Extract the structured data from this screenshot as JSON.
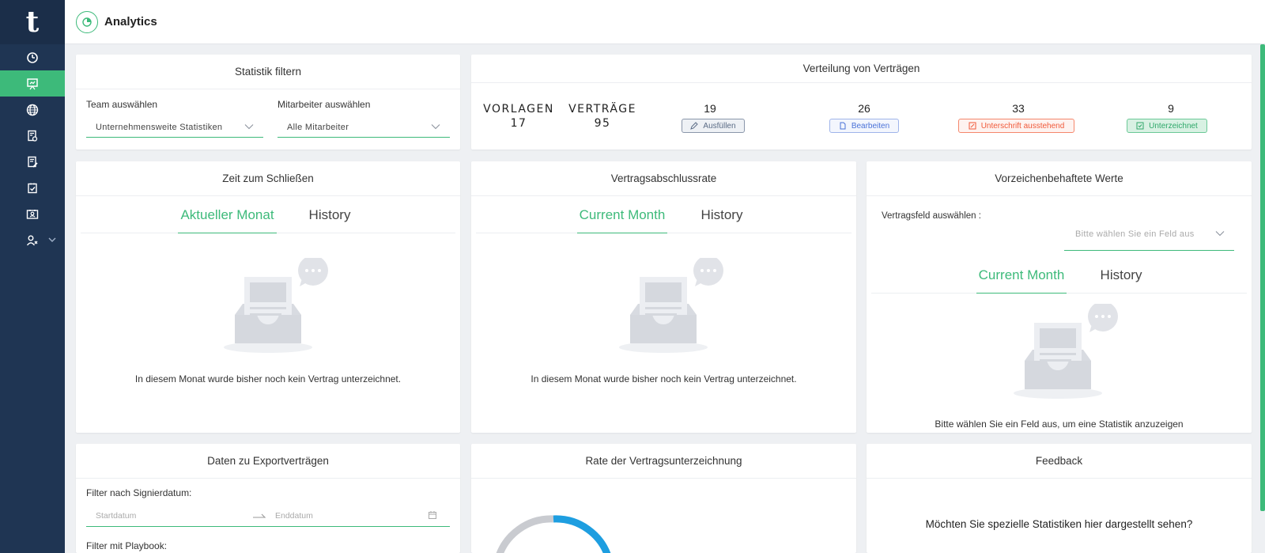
{
  "header": {
    "title": "Analytics"
  },
  "sidebar": {
    "logo": "t",
    "items": [
      "dashboard-icon",
      "presentation-icon",
      "globe-icon",
      "document-settings-icon",
      "document-edit-icon",
      "document-check-icon",
      "id-card-icon",
      "users-icon"
    ]
  },
  "filter": {
    "title": "Statistik filtern",
    "team_label": "Team auswählen",
    "team_value": "Unternehmensweite Statistiken",
    "employee_label": "Mitarbeiter auswählen",
    "employee_value": "Alle Mitarbeiter"
  },
  "distribution": {
    "title": "Verteilung von Verträgen",
    "templates_label": "VORLAGEN",
    "templates_count": "17",
    "contracts_label": "VERTRÄGE",
    "contracts_count": "95",
    "statuses": [
      {
        "count": "19",
        "label": "Ausfüllen",
        "color": "#5a6b85"
      },
      {
        "count": "26",
        "label": "Bearbeiten",
        "color": "#4a72d8"
      },
      {
        "count": "33",
        "label": "Unterschrift ausstehend",
        "color": "#f05a3a"
      },
      {
        "count": "9",
        "label": "Unterzeichnet",
        "color": "#2fa86a"
      }
    ]
  },
  "close_time": {
    "title": "Zeit zum Schließen",
    "tab_current": "Aktueller Monat",
    "tab_history": "History",
    "empty": "In diesem Monat wurde bisher noch kein Vertrag unterzeichnet."
  },
  "completion_rate": {
    "title": "Vertragsabschlussrate",
    "tab_current": "Current Month",
    "tab_history": "History",
    "empty": "In diesem Monat wurde bisher noch kein Vertrag unterzeichnet."
  },
  "signed_values": {
    "title": "Vorzeichenbehaftete Werte",
    "field_label": "Vertragsfeld auswählen :",
    "field_placeholder": "Bitte wählen Sie ein Feld aus",
    "tab_current": "Current Month",
    "tab_history": "History",
    "empty": "Bitte wählen Sie ein Feld aus, um eine Statistik anzuzeigen"
  },
  "export": {
    "title": "Daten zu Exportverträgen",
    "date_filter_label": "Filter nach Signierdatum:",
    "start_placeholder": "Startdatum",
    "end_placeholder": "Enddatum",
    "playbook_label": "Filter mit Playbook:"
  },
  "signing_rate": {
    "title": "Rate der Vertragsunterzeichnung"
  },
  "feedback": {
    "title": "Feedback",
    "question": "Möchten Sie spezielle Statistiken hier dargestellt sehen?"
  },
  "colors": {
    "accent": "#3dba7a",
    "sidebar": "#1f3553",
    "donut_blue": "#1e9ee0",
    "donut_gray": "#c9cbd0"
  }
}
